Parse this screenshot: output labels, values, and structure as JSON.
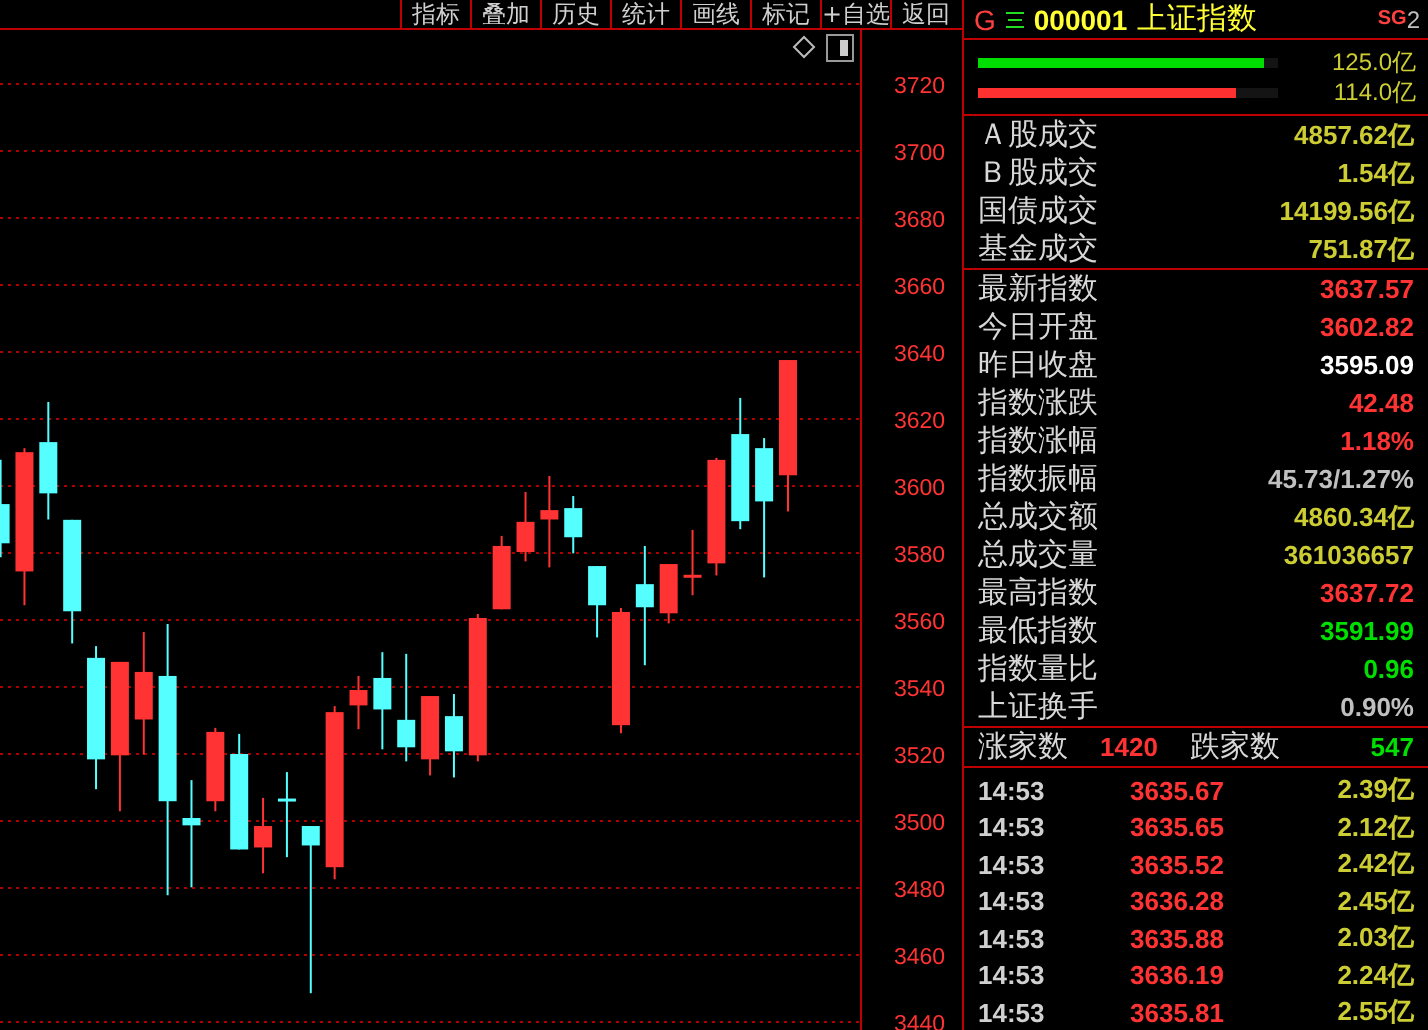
{
  "toolbar": {
    "items": [
      {
        "label": "指标"
      },
      {
        "label": "叠加"
      },
      {
        "label": "历史"
      },
      {
        "label": "统计"
      },
      {
        "label": "画线"
      },
      {
        "label": "标记"
      },
      {
        "label": "+自选"
      },
      {
        "label": "返回"
      }
    ]
  },
  "chart": {
    "chart_data": {
      "type": "candlestick",
      "ylim": [
        3440,
        3720
      ],
      "yticks": [
        3440,
        3460,
        3480,
        3500,
        3520,
        3540,
        3560,
        3580,
        3600,
        3620,
        3640,
        3660,
        3680,
        3700,
        3720
      ],
      "grid": true,
      "ohlc": [
        [
          3594.6,
          3607.8,
          3578.7,
          3582.9
        ],
        [
          3574.5,
          3611.3,
          3564.4,
          3610.1
        ],
        [
          3613.1,
          3625.1,
          3590.0,
          3597.8
        ],
        [
          3589.9,
          3589.9,
          3553.0,
          3562.6
        ],
        [
          3548.7,
          3552.2,
          3509.5,
          3518.4
        ],
        [
          3519.6,
          3547.5,
          3502.9,
          3547.5
        ],
        [
          3530.3,
          3556.4,
          3519.8,
          3544.5
        ],
        [
          3543.3,
          3558.8,
          3477.8,
          3505.9
        ],
        [
          3500.9,
          3512.2,
          3480.2,
          3498.7
        ],
        [
          3505.9,
          3527.8,
          3502.9,
          3526.6
        ],
        [
          3520.0,
          3526.0,
          3491.5,
          3491.5
        ],
        [
          3492.1,
          3506.9,
          3484.4,
          3498.5
        ],
        [
          3506.7,
          3514.6,
          3489.2,
          3506.6
        ],
        [
          3498.5,
          3498.5,
          3448.6,
          3492.7
        ],
        [
          3486.2,
          3534.3,
          3482.6,
          3532.5
        ],
        [
          3534.5,
          3543.3,
          3527.4,
          3539.1
        ],
        [
          3542.7,
          3550.4,
          3521.4,
          3533.3
        ],
        [
          3530.2,
          3549.9,
          3517.8,
          3522.0
        ],
        [
          3518.4,
          3537.3,
          3513.6,
          3537.3
        ],
        [
          3531.3,
          3537.9,
          3513.0,
          3520.8
        ],
        [
          3519.6,
          3561.8,
          3517.8,
          3560.6
        ],
        [
          3563.2,
          3585.1,
          3563.2,
          3582.1
        ],
        [
          3580.3,
          3598.2,
          3577.5,
          3589.3
        ],
        [
          3590.0,
          3603.0,
          3575.7,
          3592.8
        ],
        [
          3593.4,
          3597.0,
          3579.9,
          3584.7
        ],
        [
          3576.1,
          3576.1,
          3554.8,
          3564.4
        ],
        [
          3528.6,
          3563.6,
          3526.2,
          3562.4
        ],
        [
          3570.7,
          3582.1,
          3546.5,
          3563.8
        ],
        [
          3562.0,
          3576.7,
          3559.0,
          3576.7
        ],
        [
          3573.5,
          3586.9,
          3567.4,
          3573.5
        ],
        [
          3576.9,
          3608.4,
          3573.3,
          3607.8
        ],
        [
          3615.5,
          3626.3,
          3587.1,
          3589.5
        ],
        [
          3611.3,
          3614.3,
          3572.7,
          3595.4
        ],
        [
          3603.2,
          3637.6,
          3592.4,
          3637.6
        ]
      ]
    }
  },
  "quote_panel": {
    "market_mark": "G",
    "code": "000001",
    "name": "上证指数",
    "tag": "SG",
    "tag_suffix": "2",
    "flow_bars": [
      {
        "level": 0.95,
        "value": "125.0亿",
        "color": "#00dd00"
      },
      {
        "level": 0.86,
        "value": "114.0亿",
        "color": "#ff3030"
      }
    ],
    "volume_stats": [
      {
        "label": "Ａ股成交",
        "value": "4857.62亿",
        "color": "#cccc33"
      },
      {
        "label": "Ｂ股成交",
        "value": "1.54亿",
        "color": "#cccc33"
      },
      {
        "label": "国债成交",
        "value": "14199.56亿",
        "color": "#cccc33"
      },
      {
        "label": "基金成交",
        "value": "751.87亿",
        "color": "#cccc33"
      }
    ],
    "index_stats": [
      {
        "label": "最新指数",
        "value": "3637.57",
        "color": "#ff3333"
      },
      {
        "label": "今日开盘",
        "value": "3602.82",
        "color": "#ff3333"
      },
      {
        "label": "昨日收盘",
        "value": "3595.09",
        "color": "#ffffff"
      },
      {
        "label": "指数涨跌",
        "value": "42.48",
        "color": "#ff3333"
      },
      {
        "label": "指数涨幅",
        "value": "1.18%",
        "color": "#ff3333"
      },
      {
        "label": "指数振幅",
        "value": "45.73/1.27%",
        "color": "#c0c0c0"
      },
      {
        "label": "总成交额",
        "value": "4860.34亿",
        "color": "#cccc33"
      },
      {
        "label": "总成交量",
        "value": "361036657",
        "color": "#cccc33"
      },
      {
        "label": "最高指数",
        "value": "3637.72",
        "color": "#ff3333"
      },
      {
        "label": "最低指数",
        "value": "3591.99",
        "color": "#00e000"
      },
      {
        "label": "指数量比",
        "value": "0.96",
        "color": "#00e000"
      },
      {
        "label": "上证换手",
        "value": "0.90%",
        "color": "#c0c0c0"
      }
    ],
    "breadth": {
      "up_label": "涨家数",
      "up_count": "1420",
      "down_label": "跌家数",
      "down_count": "547"
    },
    "ticks": [
      {
        "time": "14:53",
        "price": "3635.67",
        "amount": "2.39亿"
      },
      {
        "time": "14:53",
        "price": "3635.65",
        "amount": "2.12亿"
      },
      {
        "time": "14:53",
        "price": "3635.52",
        "amount": "2.42亿"
      },
      {
        "time": "14:53",
        "price": "3636.28",
        "amount": "2.45亿"
      },
      {
        "time": "14:53",
        "price": "3635.88",
        "amount": "2.03亿"
      },
      {
        "time": "14:53",
        "price": "3636.19",
        "amount": "2.24亿"
      },
      {
        "time": "14:53",
        "price": "3635.81",
        "amount": "2.55亿"
      }
    ]
  }
}
